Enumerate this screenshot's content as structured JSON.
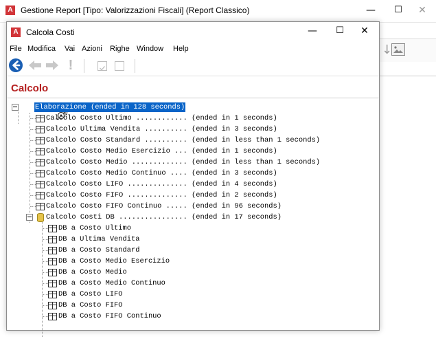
{
  "bg_window": {
    "title": "Gestione Report [Tipo: Valorizzazioni Fiscali] (Report Classico)",
    "app_icon": "A",
    "minimize": "—",
    "maximize": "☐",
    "close": "✕"
  },
  "dialog": {
    "title": "Calcola Costi",
    "app_icon": "A",
    "minimize": "—",
    "maximize": "☐",
    "close": "✕"
  },
  "menu": [
    "File",
    "Modifica",
    "Vai",
    "Azioni",
    "Righe",
    "Window",
    "Help"
  ],
  "section_title": "Calcolo",
  "tree": {
    "root": "Elaborazione (ended in 128 seconds)",
    "items": [
      "Calcolo Costo Ultimo ............ (ended in 1 seconds)",
      "Calcolo Ultima Vendita .......... (ended in 3 seconds)",
      "Calcolo Costo Standard .......... (ended in less than 1 seconds)",
      "Calcolo Costo Medio Esercizio ... (ended in 1 seconds)",
      "Calcolo Costo Medio ............. (ended in less than 1 seconds)",
      "Calcolo Costo Medio Continuo .... (ended in 3 seconds)",
      "Calcolo Costo LIFO .............. (ended in 4 seconds)",
      "Calcolo Costo FIFO .............. (ended in 2 seconds)",
      "Calcolo Costo FIFO Continuo ..... (ended in 96 seconds)"
    ],
    "db_group": "Calcolo Costi DB ................ (ended in 17 seconds)",
    "db_items": [
      "DB a Costo Ultimo",
      "DB a Ultima Vendita",
      "DB a Costo Standard",
      "DB a Costo Medio Esercizio",
      "DB a Costo Medio",
      "DB a Costo Medio Continuo",
      "DB a Costo LIFO",
      "DB a Costo FIFO",
      "DB a Costo FIFO Continuo"
    ]
  },
  "icons": {
    "back": "back-circle-icon",
    "left": "left-arrow-icon",
    "right": "right-arrow-icon",
    "exclamation": "exclamation-icon",
    "table": "table-icon",
    "database": "database-icon",
    "process": "process-icon"
  },
  "colors": {
    "accent": "#0a64c8",
    "title_red": "#b52020",
    "app_icon_red": "#d13438"
  }
}
